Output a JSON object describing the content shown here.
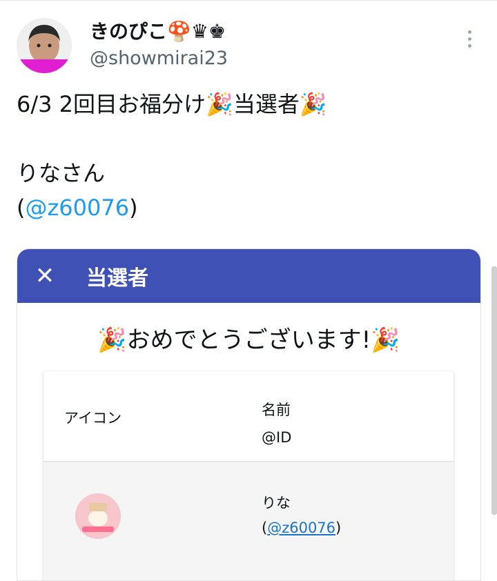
{
  "tweet": {
    "display_name": "きのぴこ🍄♛♚",
    "handle": "@showmirai23",
    "line1": "6/3 2回目お福分け🎉当選者🎉",
    "line2": "りなさん",
    "mention_open": "(",
    "mention": "@z60076",
    "mention_close": ")"
  },
  "card": {
    "close_label": "✕",
    "title": "当選者",
    "congrats": "🎉おめでとうございます!🎉",
    "columns": {
      "icon": "アイコン",
      "name": "名前",
      "id": "@ID"
    },
    "rows": [
      {
        "name": "りな",
        "id": "@z60076",
        "id_open": "(",
        "id_close": ")"
      }
    ]
  },
  "colors": {
    "header": "#3f51b5",
    "link": "#1d9bf0",
    "handle": "#536471"
  },
  "icons": [
    "avatar",
    "more-icon",
    "close-icon"
  ]
}
